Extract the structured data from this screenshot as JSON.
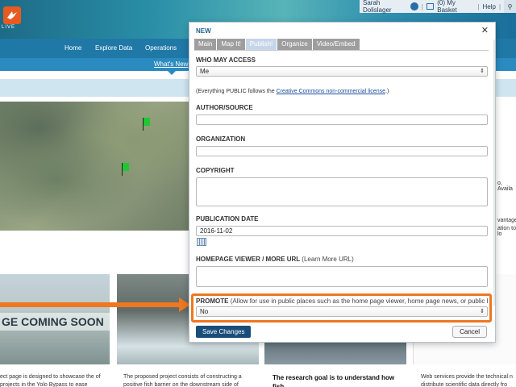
{
  "site": {
    "logo_text": "LIVE",
    "user_name": "Sarah Dolislager",
    "basket": "(0) My Basket",
    "help": "Help",
    "nav": [
      "Home",
      "Explore Data",
      "Operations"
    ],
    "subnav_link": "What's New",
    "coming_soon": "GE COMING SOON",
    "tiles": {
      "t1_text": "ect page is designed to showcase the of projects in the Yolo Bypass to ease",
      "t2_text": "The proposed project consists of constructing a positive fish barrier on the downstream side of",
      "t3_head": "The research goal is to understand how fish",
      "t4_text": "Web services provide the technical n distribute scientific data directly fro"
    },
    "right_snippets": [
      "o, Availa",
      "vantage",
      "ation to lo"
    ]
  },
  "modal": {
    "title": "NEW",
    "tabs": [
      "Main",
      "Map It!",
      "Publish!",
      "Organize",
      "Video/Embed"
    ],
    "active_tab": "Publish!",
    "who_may_access": {
      "label": "WHO MAY ACCESS",
      "value": "Me"
    },
    "cc_note_prefix": "(Everything PUBLIC follows the ",
    "cc_link": "Creative Commons non-commercial license",
    "cc_note_suffix": ".)",
    "author": {
      "label": "AUTHOR/SOURCE",
      "value": ""
    },
    "organization": {
      "label": "ORGANIZATION",
      "value": ""
    },
    "copyright": {
      "label": "COPYRIGHT",
      "value": ""
    },
    "publication_date": {
      "label": "PUBLICATION DATE",
      "value": "2016-11-02"
    },
    "homepage_viewer": {
      "label": "HOMEPAGE VIEWER / MORE URL",
      "hint": "(Learn More URL)",
      "value": ""
    },
    "promote": {
      "label": "PROMOTE",
      "hint": "(Allow for use in public places such as the home page viewer, home page news, or public RSS Feeds?)",
      "value": "No"
    },
    "save_label": "Save Changes",
    "cancel_label": "Cancel"
  },
  "colors": {
    "highlight": "#ee7720",
    "nav": "#1f78a6",
    "save_button": "#1a4d7a"
  }
}
